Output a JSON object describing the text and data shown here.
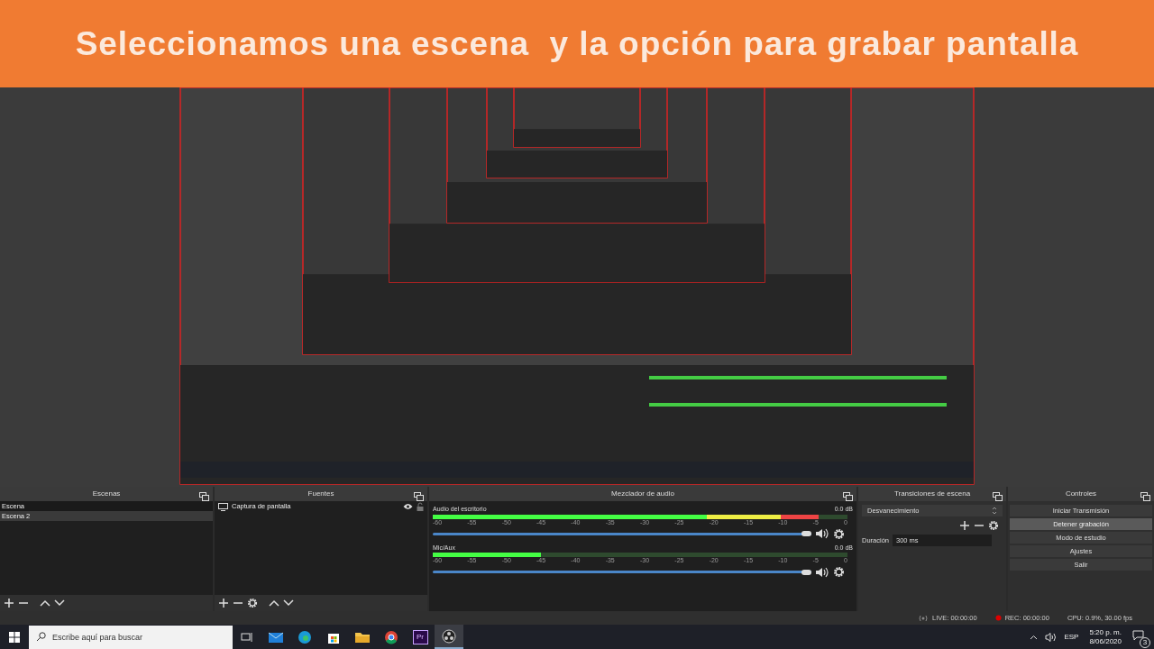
{
  "banner": {
    "title": "Seleccionamos una escena  y la opción para grabar pantalla"
  },
  "scenes": {
    "title": "Escenas",
    "items": [
      {
        "label": "Escena",
        "selected": false
      },
      {
        "label": "Escena 2",
        "selected": true
      }
    ]
  },
  "sources": {
    "title": "Fuentes",
    "items": [
      {
        "label": "Captura de pantalla",
        "visible": true,
        "locked": false
      }
    ]
  },
  "mixer": {
    "title": "Mezclador de audio",
    "channels": [
      {
        "name": "Audio del escritorio",
        "reading": "0.0 dB",
        "meter": {
          "level": 0.93
        },
        "scale": [
          "-60",
          "-55",
          "-50",
          "-45",
          "-40",
          "-35",
          "-30",
          "-25",
          "-20",
          "-15",
          "-10",
          "-5",
          "0"
        ],
        "volume": {
          "level": 1
        }
      },
      {
        "name": "Mic/Aux",
        "reading": "0.0 dB",
        "meter": {
          "level": 0.26
        },
        "scale": [
          "-60",
          "-55",
          "-50",
          "-45",
          "-40",
          "-35",
          "-30",
          "-25",
          "-20",
          "-15",
          "-10",
          "-5",
          "0"
        ],
        "volume": {
          "level": 1
        }
      }
    ]
  },
  "transitions": {
    "title": "Transiciones de escena",
    "type": "Desvanecimiento",
    "duration_label": "Duración",
    "duration": "300 ms"
  },
  "controls": {
    "title": "Controles",
    "buttons": [
      {
        "label": "Iniciar Transmisión",
        "highlighted": false
      },
      {
        "label": "Detener grabación",
        "highlighted": true
      },
      {
        "label": "Modo de estudio",
        "highlighted": false
      },
      {
        "label": "Ajustes",
        "highlighted": false
      },
      {
        "label": "Salir",
        "highlighted": false
      }
    ]
  },
  "status_bar": {
    "live": "LIVE: 00:00:00",
    "rec": "REC: 00:00:00",
    "cpu": "CPU: 0.9%, 30.00 fps"
  },
  "taskbar": {
    "search_placeholder": "Escribe aquí para buscar",
    "apps": [
      {
        "kind": "taskview",
        "active": false
      },
      {
        "kind": "mail",
        "active": false
      },
      {
        "kind": "edge",
        "active": false
      },
      {
        "kind": "store",
        "active": false
      },
      {
        "kind": "folder",
        "active": false
      },
      {
        "kind": "chrome",
        "active": false
      },
      {
        "kind": "premiere",
        "label": "Pr",
        "active": false
      },
      {
        "kind": "obs",
        "active": true
      }
    ],
    "language": "ESP",
    "time": "5:20 p. m.",
    "date": "8/06/2020",
    "notifications": "3"
  }
}
